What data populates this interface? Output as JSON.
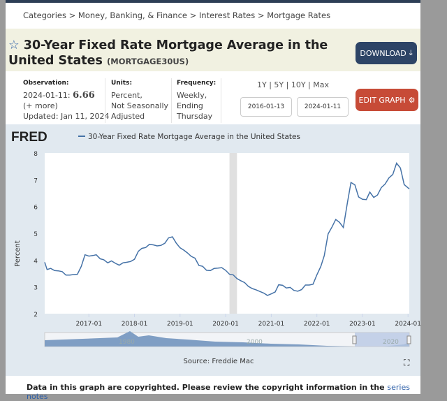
{
  "breadcrumb": "Categories > Money, Banking, & Finance > Interest Rates > Mortgage Rates",
  "title": "30-Year Fixed Rate Mortgage Average in the United States",
  "series_id": "(MORTGAGE30US)",
  "download_label": "DOWNLOAD",
  "edit_graph_label": "EDIT GRAPH",
  "observation": {
    "label": "Observation:",
    "date": "2024-01-11:",
    "value": "6.66",
    "more": "(+ more)",
    "updated": "Updated: Jan 11, 2024"
  },
  "units": {
    "label": "Units:",
    "l1": "Percent,",
    "l2": "Not Seasonally",
    "l3": "Adjusted"
  },
  "frequency": {
    "label": "Frequency:",
    "l1": "Weekly,",
    "l2": "Ending",
    "l3": "Thursday"
  },
  "ranges": "1Y | 5Y | 10Y | Max",
  "start_date": "2016-01-13",
  "end_date": "2024-01-11",
  "logo": "FRED",
  "source": "Source: Freddie Mac",
  "note": "Data in this graph are copyrighted. Please review the copyright information in the",
  "note_link": "series notes",
  "navigator_labels": [
    "1980",
    "2000",
    "2020"
  ],
  "colors": {
    "line": "#4572a7",
    "recession": "#e0e0e0",
    "download": "#2d4466",
    "edit": "#c74b37"
  },
  "chart_data": {
    "type": "line",
    "legend": "30-Year Fixed Rate Mortgage Average in the United States",
    "ylabel": "Percent",
    "ylim": [
      2,
      8
    ],
    "yticks": [
      2,
      3,
      4,
      5,
      6,
      7,
      8
    ],
    "xlim": [
      "2016-01-13",
      "2024-01-11"
    ],
    "xticks": [
      "2017-01",
      "2018-01",
      "2019-01",
      "2020-01",
      "2021-01",
      "2022-01",
      "2023-01",
      "2024-01"
    ],
    "recession": [
      "2020-02",
      "2020-04"
    ],
    "grid": false,
    "series": [
      {
        "points": [
          [
            "2016-01",
            3.92
          ],
          [
            "2016-02",
            3.65
          ],
          [
            "2016-03",
            3.69
          ],
          [
            "2016-04",
            3.61
          ],
          [
            "2016-05",
            3.6
          ],
          [
            "2016-06",
            3.57
          ],
          [
            "2016-07",
            3.44
          ],
          [
            "2016-08",
            3.44
          ],
          [
            "2016-09",
            3.46
          ],
          [
            "2016-10",
            3.47
          ],
          [
            "2016-11",
            3.77
          ],
          [
            "2016-12",
            4.2
          ],
          [
            "2017-01",
            4.15
          ],
          [
            "2017-02",
            4.17
          ],
          [
            "2017-03",
            4.2
          ],
          [
            "2017-04",
            4.05
          ],
          [
            "2017-05",
            4.01
          ],
          [
            "2017-06",
            3.9
          ],
          [
            "2017-07",
            3.97
          ],
          [
            "2017-08",
            3.88
          ],
          [
            "2017-09",
            3.81
          ],
          [
            "2017-10",
            3.9
          ],
          [
            "2017-11",
            3.92
          ],
          [
            "2017-12",
            3.95
          ],
          [
            "2018-01",
            4.03
          ],
          [
            "2018-02",
            4.33
          ],
          [
            "2018-03",
            4.44
          ],
          [
            "2018-04",
            4.47
          ],
          [
            "2018-05",
            4.59
          ],
          [
            "2018-06",
            4.57
          ],
          [
            "2018-07",
            4.53
          ],
          [
            "2018-08",
            4.55
          ],
          [
            "2018-09",
            4.63
          ],
          [
            "2018-10",
            4.83
          ],
          [
            "2018-11",
            4.87
          ],
          [
            "2018-12",
            4.64
          ],
          [
            "2019-01",
            4.46
          ],
          [
            "2019-02",
            4.37
          ],
          [
            "2019-03",
            4.27
          ],
          [
            "2019-04",
            4.14
          ],
          [
            "2019-05",
            4.07
          ],
          [
            "2019-06",
            3.8
          ],
          [
            "2019-07",
            3.77
          ],
          [
            "2019-08",
            3.62
          ],
          [
            "2019-09",
            3.61
          ],
          [
            "2019-10",
            3.69
          ],
          [
            "2019-11",
            3.7
          ],
          [
            "2019-12",
            3.72
          ],
          [
            "2020-01",
            3.62
          ],
          [
            "2020-02",
            3.47
          ],
          [
            "2020-03",
            3.45
          ],
          [
            "2020-04",
            3.31
          ],
          [
            "2020-05",
            3.23
          ],
          [
            "2020-06",
            3.16
          ],
          [
            "2020-07",
            3.02
          ],
          [
            "2020-08",
            2.94
          ],
          [
            "2020-09",
            2.89
          ],
          [
            "2020-10",
            2.83
          ],
          [
            "2020-11",
            2.77
          ],
          [
            "2020-12",
            2.68
          ],
          [
            "2021-01",
            2.74
          ],
          [
            "2021-02",
            2.81
          ],
          [
            "2021-03",
            3.08
          ],
          [
            "2021-04",
            3.06
          ],
          [
            "2021-05",
            2.96
          ],
          [
            "2021-06",
            2.98
          ],
          [
            "2021-07",
            2.87
          ],
          [
            "2021-08",
            2.84
          ],
          [
            "2021-09",
            2.9
          ],
          [
            "2021-10",
            3.07
          ],
          [
            "2021-11",
            3.07
          ],
          [
            "2021-12",
            3.1
          ],
          [
            "2022-01",
            3.45
          ],
          [
            "2022-02",
            3.76
          ],
          [
            "2022-03",
            4.17
          ],
          [
            "2022-04",
            4.98
          ],
          [
            "2022-05",
            5.23
          ],
          [
            "2022-06",
            5.52
          ],
          [
            "2022-07",
            5.41
          ],
          [
            "2022-08",
            5.22
          ],
          [
            "2022-09",
            6.11
          ],
          [
            "2022-10",
            6.9
          ],
          [
            "2022-11",
            6.81
          ],
          [
            "2022-12",
            6.36
          ],
          [
            "2023-01",
            6.27
          ],
          [
            "2023-02",
            6.26
          ],
          [
            "2023-03",
            6.54
          ],
          [
            "2023-04",
            6.34
          ],
          [
            "2023-05",
            6.43
          ],
          [
            "2023-06",
            6.71
          ],
          [
            "2023-07",
            6.84
          ],
          [
            "2023-08",
            7.07
          ],
          [
            "2023-09",
            7.2
          ],
          [
            "2023-10",
            7.62
          ],
          [
            "2023-11",
            7.44
          ],
          [
            "2023-12",
            6.82
          ],
          [
            "2024-01",
            6.66
          ]
        ]
      }
    ]
  }
}
